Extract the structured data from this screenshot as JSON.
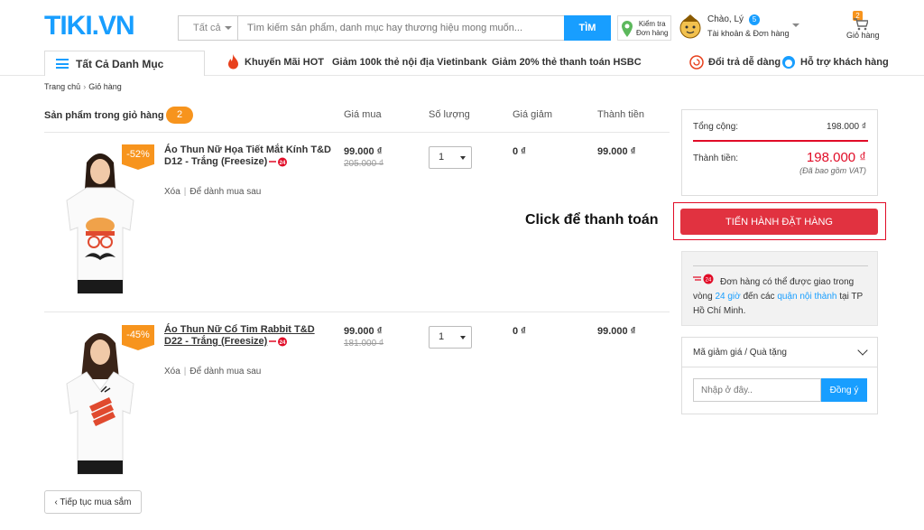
{
  "header": {
    "logo": "TIKI.VN",
    "search": {
      "category": "Tất cả",
      "placeholder": "Tìm kiếm sản phẩm, danh mục hay thương hiệu mong muốn...",
      "button": "TÌM"
    },
    "track_order": {
      "line1": "Kiểm tra",
      "line2": "Đơn hàng"
    },
    "account": {
      "greeting": "Chào, Lý",
      "notifications": "5",
      "subtitle": "Tài khoản & Đơn hàng"
    },
    "cart": {
      "count": "2",
      "label": "Giỏ hàng"
    }
  },
  "nav": {
    "all_categories": "Tất Cả Danh Mục",
    "links": [
      "Khuyến Mãi HOT",
      "Giảm 100k thẻ nội địa Vietinbank",
      "Giảm 20% thẻ thanh toán HSBC"
    ],
    "returns": "Đổi trả dễ dàng",
    "support": "Hỗ trợ khách hàng"
  },
  "breadcrumb": {
    "home": "Trang chủ",
    "current": "Giỏ hàng"
  },
  "cart": {
    "title": "Sản phẩm trong giỏ hàng",
    "count": "2",
    "columns": {
      "price": "Giá mua",
      "qty": "Số lượng",
      "discount": "Giá giảm",
      "total": "Thành tiền"
    },
    "items": [
      {
        "discount_badge": "-52%",
        "name": "Áo Thun Nữ Họa Tiết Mắt Kính T&D D12 - Trắng (Freesize)",
        "price": "99.000 ₫",
        "old_price": "205.000 ₫",
        "qty": "1",
        "discount": "0 ₫",
        "total": "99.000 ₫",
        "remove": "Xóa",
        "save_later": "Để dành mua sau"
      },
      {
        "discount_badge": "-45%",
        "name": "Áo Thun Nữ Cổ Tim Rabbit T&D D22 - Trắng (Freesize)",
        "price": "99.000 ₫",
        "old_price": "181.000 ₫",
        "qty": "1",
        "discount": "0 ₫",
        "total": "99.000 ₫",
        "remove": "Xóa",
        "save_later": "Để dành mua sau"
      }
    ],
    "continue": "Tiếp tục mua sắm"
  },
  "summary": {
    "subtotal_label": "Tổng cộng:",
    "subtotal": "198.000 ₫",
    "total_label": "Thành tiền:",
    "total": "198.000 ₫",
    "vat_note": "(Đã bao gồm VAT)"
  },
  "callout": "Click để thanh toán",
  "order_button": "TIẾN HÀNH ĐẶT HÀNG",
  "shipping": {
    "t1": "Đơn hàng có thể được giao trong vòng ",
    "h1": "24 giờ",
    "t2": " đến các ",
    "h2": "quận nội thành",
    "t3": " tại TP Hồ Chí Minh."
  },
  "coupon": {
    "title": "Mã giảm giá / Quà tặng",
    "placeholder": "Nhập ở đây..",
    "button": "Đồng ý"
  },
  "colors": {
    "brand": "#189eff",
    "accent": "#e10c27",
    "orange": "#f7941d"
  }
}
